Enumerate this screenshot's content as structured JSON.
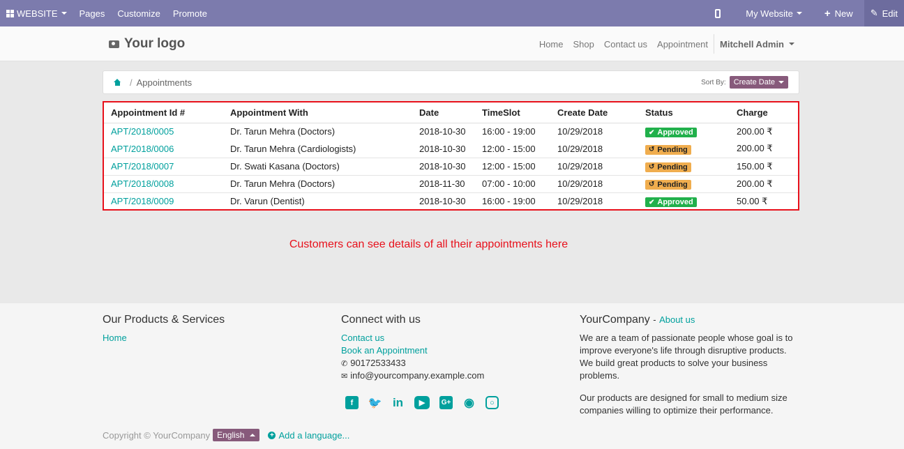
{
  "adminbar": {
    "website": "WEBSITE",
    "pages": "Pages",
    "customize": "Customize",
    "promote": "Promote",
    "my_website": "My Website",
    "new": "New",
    "edit": "Edit"
  },
  "header": {
    "logo": "Your logo",
    "nav": [
      "Home",
      "Shop",
      "Contact us",
      "Appointment"
    ],
    "user": "Mitchell Admin"
  },
  "breadcrumb": {
    "sep": "/",
    "current": "Appointments",
    "sort_label": "Sort By:",
    "sort_value": "Create Date"
  },
  "table": {
    "headers": [
      "Appointment Id #",
      "Appointment With",
      "Date",
      "TimeSlot",
      "Create Date",
      "Status",
      "Charge"
    ],
    "rows": [
      {
        "id": "APT/2018/0005",
        "with": "Dr. Tarun Mehra (Doctors)",
        "date": "2018-10-30",
        "slot": "16:00 - 19:00",
        "created": "10/29/2018",
        "status": "Approved",
        "charge": "200.00 ₹"
      },
      {
        "id": "APT/2018/0006",
        "with": "Dr. Tarun Mehra (Cardiologists)",
        "date": "2018-10-30",
        "slot": "12:00 - 15:00",
        "created": "10/29/2018",
        "status": "Pending",
        "charge": "200.00 ₹"
      },
      {
        "id": "APT/2018/0007",
        "with": "Dr. Swati Kasana (Doctors)",
        "date": "2018-10-30",
        "slot": "12:00 - 15:00",
        "created": "10/29/2018",
        "status": "Pending",
        "charge": "150.00 ₹"
      },
      {
        "id": "APT/2018/0008",
        "with": "Dr. Tarun Mehra (Doctors)",
        "date": "2018-11-30",
        "slot": "07:00 - 10:00",
        "created": "10/29/2018",
        "status": "Pending",
        "charge": "200.00 ₹"
      },
      {
        "id": "APT/2018/0009",
        "with": "Dr. Varun (Dentist)",
        "date": "2018-10-30",
        "slot": "16:00 - 19:00",
        "created": "10/29/2018",
        "status": "Approved",
        "charge": "50.00 ₹"
      }
    ]
  },
  "note": "Customers can see details of all their appointments here",
  "footer": {
    "products": {
      "title": "Our Products & Services",
      "home": "Home"
    },
    "connect": {
      "title": "Connect with us",
      "contact": "Contact us",
      "book": "Book an Appointment",
      "phone": "90172533433",
      "email": "info@yourcompany.example.com"
    },
    "company": {
      "name": "YourCompany",
      "dash": "-",
      "about": "About us",
      "p1": "We are a team of passionate people whose goal is to improve everyone's life through disruptive products. We build great products to solve your business problems.",
      "p2": "Our products are designed for small to medium size companies willing to optimize their performance."
    },
    "copyright": "Copyright © YourCompany",
    "language": "English",
    "add_language": "Add a language..."
  },
  "colors": {
    "admin_bar": "#7c7bad",
    "accent": "#00a09d",
    "primary": "#875a7b",
    "approved": "#21b04b",
    "pending": "#f0ad4e",
    "highlight": "#e8101b"
  },
  "icons": [
    "apps-grid-icon",
    "mobile-icon",
    "plus-icon",
    "pencil-icon",
    "camera-icon",
    "home-icon",
    "check-icon",
    "clock-icon",
    "phone-icon",
    "envelope-icon",
    "facebook-icon",
    "twitter-icon",
    "linkedin-icon",
    "youtube-icon",
    "google-plus-icon",
    "github-icon",
    "instagram-icon"
  ]
}
